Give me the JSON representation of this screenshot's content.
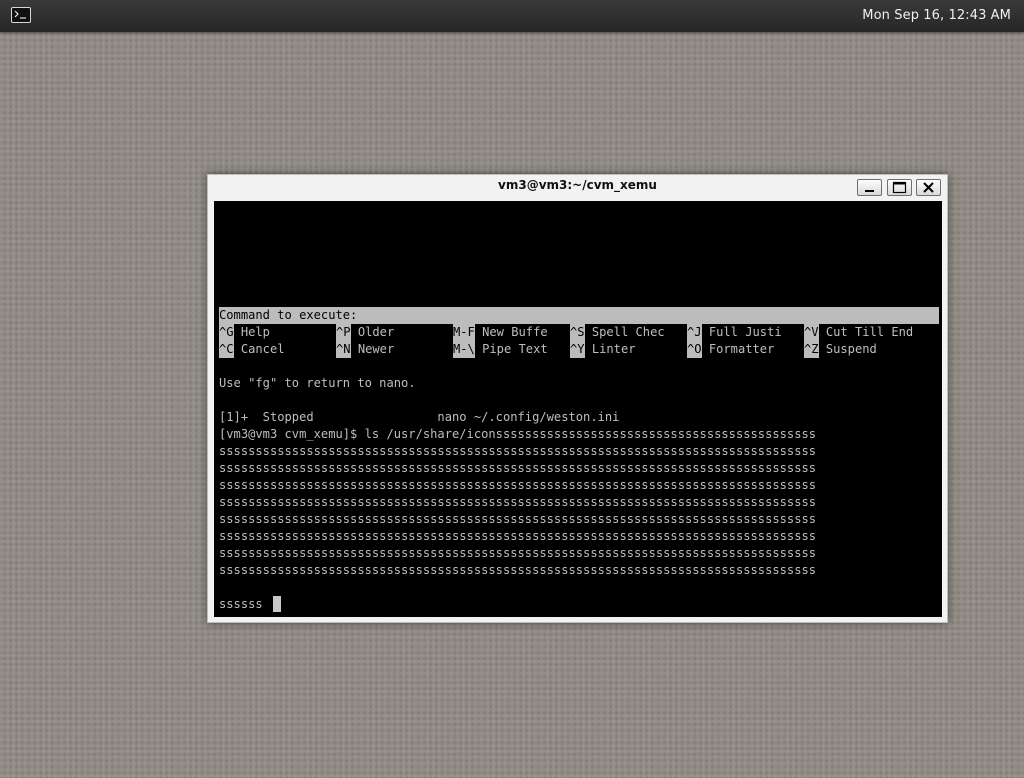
{
  "panel": {
    "launcher_icon": "terminal-icon",
    "clock": "Mon Sep 16, 12:43 AM"
  },
  "window": {
    "title": "vm3@vm3:~/cvm_xemu",
    "buttons": {
      "minimize_icon": "minimize-icon",
      "maximize_icon": "maximize-icon",
      "close_icon": "close-icon"
    }
  },
  "terminal": {
    "nano_status": "Command to execute:",
    "shortcuts_row1": [
      {
        "key": "^G",
        "label": "Help"
      },
      {
        "key": "^P",
        "label": "Older"
      },
      {
        "key": "M-F",
        "label": "New Buffe"
      },
      {
        "key": "^S",
        "label": "Spell Chec"
      },
      {
        "key": "^J",
        "label": "Full Justi"
      },
      {
        "key": "^V",
        "label": "Cut Till End"
      }
    ],
    "shortcuts_row2": [
      {
        "key": "^C",
        "label": "Cancel"
      },
      {
        "key": "^N",
        "label": "Newer"
      },
      {
        "key": "M-\\",
        "label": "Pipe Text"
      },
      {
        "key": "^Y",
        "label": "Linter"
      },
      {
        "key": "^O",
        "label": "Formatter"
      },
      {
        "key": "^Z",
        "label": "Suspend"
      }
    ],
    "lines": [
      "Use \"fg\" to return to nano.",
      "",
      "[1]+  Stopped                 nano ~/.config/weston.ini",
      "[vm3@vm3 cvm_xemu]$ ls /usr/share/iconssssssssssssssssssssssssssssssssssssssssssss",
      "ssssssssssssssssssssssssssssssssssssssssssssssssssssssssssssssssssssssssssssssssss",
      "ssssssssssssssssssssssssssssssssssssssssssssssssssssssssssssssssssssssssssssssssss",
      "ssssssssssssssssssssssssssssssssssssssssssssssssssssssssssssssssssssssssssssssssss",
      "ssssssssssssssssssssssssssssssssssssssssssssssssssssssssssssssssssssssssssssssssss",
      "ssssssssssssssssssssssssssssssssssssssssssssssssssssssssssssssssssssssssssssssssss",
      "ssssssssssssssssssssssssssssssssssssssssssssssssssssssssssssssssssssssssssssssssss",
      "ssssssssssssssssssssssssssssssssssssssssssssssssssssssssssssssssssssssssssssssssss",
      "ssssssssssssssssssssssssssssssssssssssssssssssssssssssssssssssssssssssssssssssssss",
      "ssssss"
    ]
  }
}
